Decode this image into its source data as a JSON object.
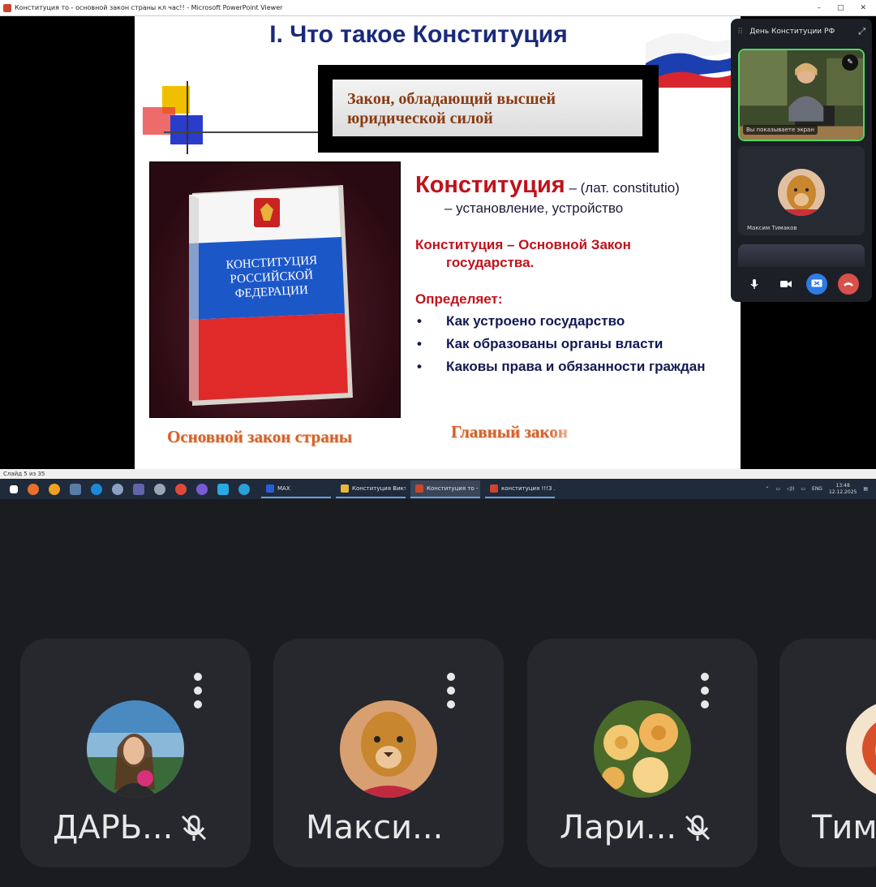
{
  "window": {
    "title": "Конституция то - основной закон страны кл час!! - Microsoft PowerPoint Viewer",
    "controls": [
      "–",
      "□",
      "✕"
    ]
  },
  "slide": {
    "title": "I. Что такое Конституция",
    "law_box_line1": "Закон, обладающий высшей",
    "law_box_line2": "юридической силой",
    "book_lines": [
      "КОНСТИТУЦИЯ",
      "РОССИЙСКОЙ",
      "ФЕДЕРАЦИИ"
    ],
    "def_term": "Конституция",
    "def_rest": " – (лат. constitutio)",
    "def_line2": "– установление, устройство",
    "main_law_line1": "Конституция – Основной Закон",
    "main_law_line2": "государства.",
    "defines_label": "Определяет:",
    "bullets": [
      "Как устроено государство",
      "Как образованы органы власти",
      "Каковы права и обязанности граждан"
    ],
    "caption_left": "Основной закон страны",
    "caption_right": "Главный закон"
  },
  "status_bar": {
    "text": "Слайд 5 из 35"
  },
  "taskbar": {
    "apps": [
      {
        "label": "MAX",
        "color": "#2b5cd6"
      },
      {
        "label": "Конституция Викт...",
        "color": "#e6b93a"
      },
      {
        "label": "Конституция то - о...",
        "color": "#c9462c"
      },
      {
        "label": "конституция !!!3 ...",
        "color": "#c9462c"
      }
    ],
    "language": "ENG",
    "time": "13:48",
    "date": "12.12.2025"
  },
  "meeting_popup": {
    "title": "День Конституции РФ",
    "self_share_label": "Вы показываете экран",
    "participant_name": "Максим Тимаков"
  },
  "participants": [
    {
      "name": "ДАРЬ...",
      "muted": true
    },
    {
      "name": "Макси...",
      "muted": false
    },
    {
      "name": "Лари...",
      "muted": true
    },
    {
      "name": "Тиму",
      "muted": false
    }
  ]
}
